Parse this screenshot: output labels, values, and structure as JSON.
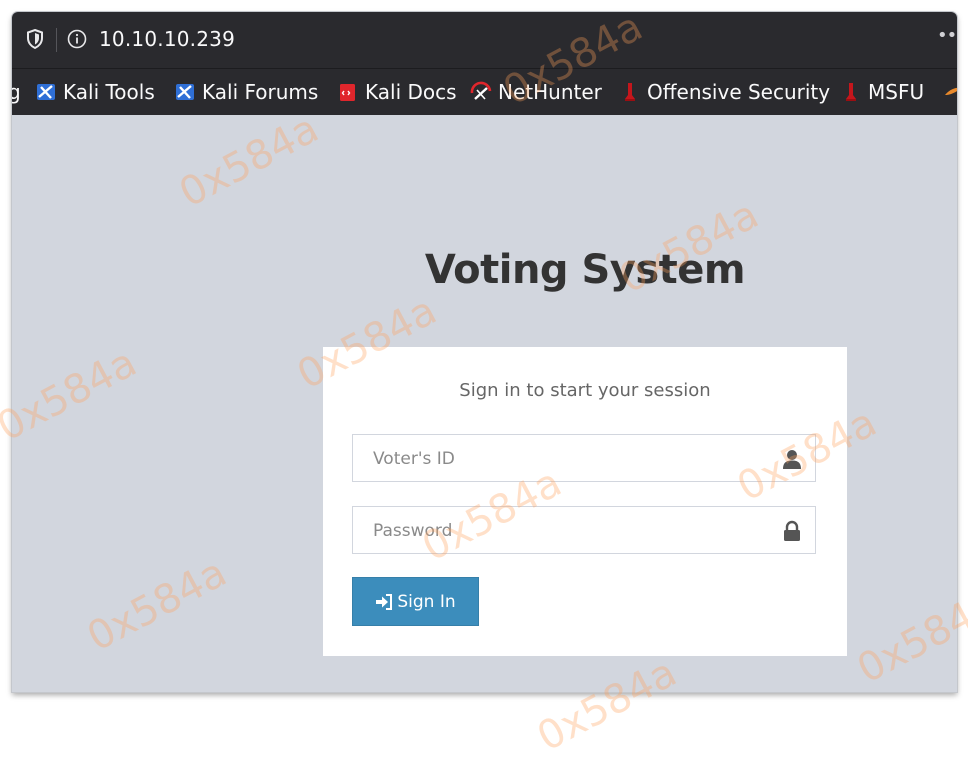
{
  "browser": {
    "url": "10.10.10.239",
    "more_glyph": "••"
  },
  "bookmarks": [
    {
      "label": "g",
      "icon": "bookmark-icon"
    },
    {
      "label": "Kali Tools",
      "icon": "kali-dragon-icon"
    },
    {
      "label": "Kali Forums",
      "icon": "kali-dragon-icon"
    },
    {
      "label": "Kali Docs",
      "icon": "kali-docs-icon"
    },
    {
      "label": "NetHunter",
      "icon": "nethunter-icon"
    },
    {
      "label": "Offensive Security",
      "icon": "offsec-icon"
    },
    {
      "label": "MSFU",
      "icon": "offsec-icon"
    }
  ],
  "page": {
    "title": "Voting System",
    "login_message": "Sign in to start your session",
    "voter_id_placeholder": "Voter's ID",
    "password_placeholder": "Password",
    "signin_label": "Sign In"
  },
  "watermark": {
    "text": "0x584a",
    "color": "#ffa05a"
  },
  "colors": {
    "toolbar": "#2a2a2e",
    "page_bg": "#d2d6de",
    "button": "#3c8dbc",
    "title": "#333333"
  }
}
